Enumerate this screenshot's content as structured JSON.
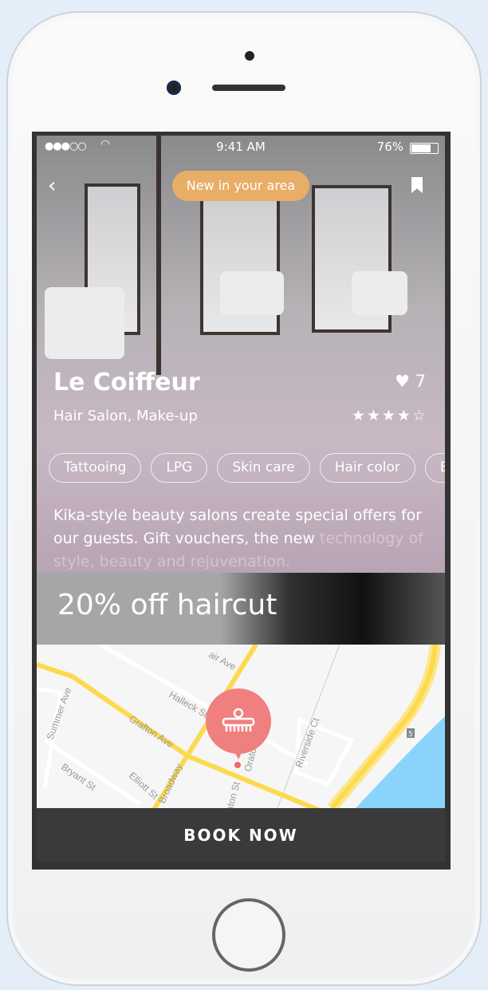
{
  "status_bar": {
    "signal": "●●●○○",
    "time": "9:41 AM",
    "battery_percent": "76%",
    "battery_level": 0.76
  },
  "header": {
    "badge": "New in your area",
    "back_icon": "chevron-left-icon",
    "bookmark_icon": "bookmark-icon"
  },
  "salon": {
    "name": "Le Coiffeur",
    "category": "Hair Salon, Make-up",
    "likes": "7",
    "rating": 4,
    "rating_max": 5,
    "stars": "★★★★☆"
  },
  "tags": [
    "Tattooing",
    "LPG",
    "Skin care",
    "Hair color",
    "Bo"
  ],
  "description": {
    "visible": "Kika-style beauty salons create special offers for our guests.  Gift vouchers, the new",
    "faded": "technology of style, beauty and rejuvenation."
  },
  "promo": {
    "text": "20% off haircut"
  },
  "map": {
    "streets": [
      "air Ave",
      "Halleck St",
      "Grafton Ave",
      "Summer Ave",
      "Bryant St",
      "Elliott St",
      "Broadway",
      "Orato",
      "aton St",
      "Riverside Ct"
    ],
    "route_shield": "5",
    "pin_icon": "comb-icon",
    "pin_color": "#f08080",
    "water_color": "#8ad4fc",
    "road_color": "#fdd94e"
  },
  "cta": {
    "label": "BOOK NOW"
  },
  "colors": {
    "badge": "#e8ad66",
    "cta_bg": "#3a3a3a"
  }
}
